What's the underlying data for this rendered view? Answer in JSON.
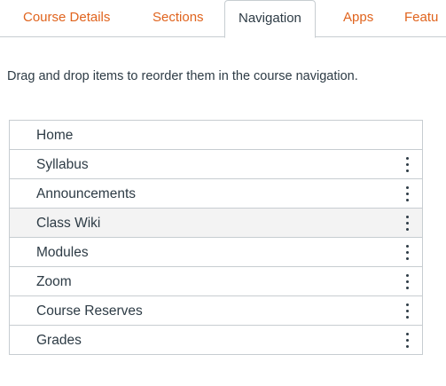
{
  "tabs": [
    {
      "label": "Course Details",
      "active": false
    },
    {
      "label": "Sections",
      "active": false
    },
    {
      "label": "Navigation",
      "active": true
    },
    {
      "label": "Apps",
      "active": false
    },
    {
      "label": "Featu",
      "active": false
    }
  ],
  "instructions": "Drag and drop items to reorder them in the course navigation.",
  "nav_items": [
    {
      "label": "Home",
      "has_menu": false
    },
    {
      "label": "Syllabus",
      "has_menu": true
    },
    {
      "label": "Announcements",
      "has_menu": true
    },
    {
      "label": "Class Wiki",
      "has_menu": true,
      "highlighted": true
    },
    {
      "label": "Modules",
      "has_menu": true
    },
    {
      "label": "Zoom",
      "has_menu": true
    },
    {
      "label": "Course Reserves",
      "has_menu": true
    },
    {
      "label": "Grades",
      "has_menu": true
    }
  ],
  "icons": {
    "item_menu": "kebab-menu-icon"
  },
  "colors": {
    "tab_link": "#e0641e",
    "text": "#2d3b45",
    "border": "#c7cdd1",
    "row_highlight": "#f3f3f3"
  }
}
